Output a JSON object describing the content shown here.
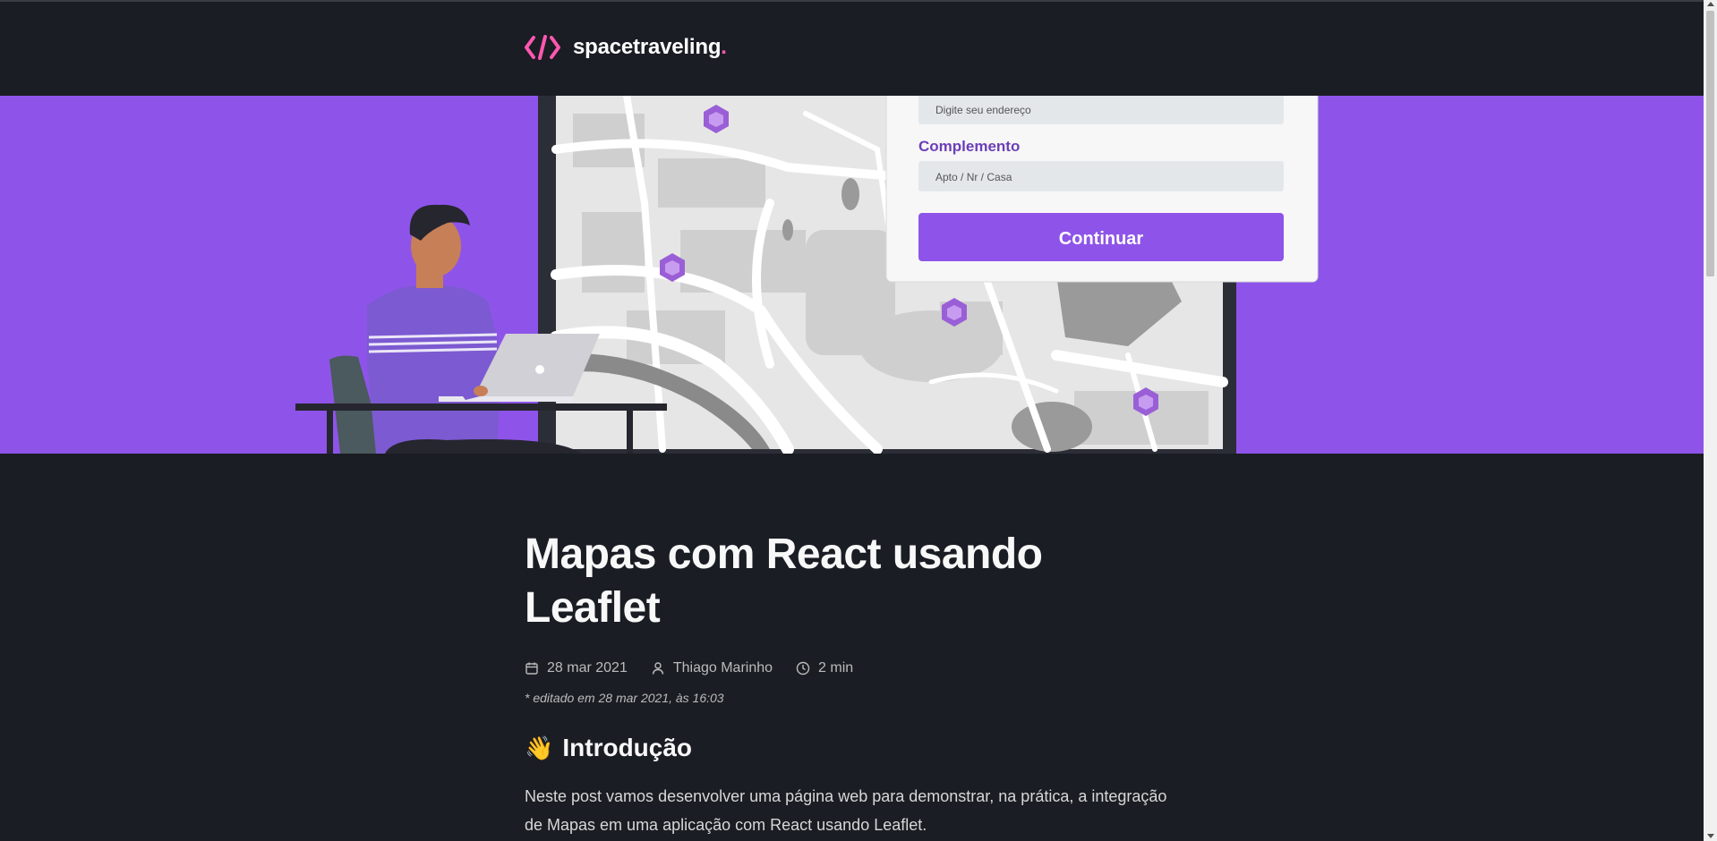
{
  "header": {
    "logo_symbol": "</>",
    "logo_text": "spacetraveling",
    "logo_dot": ".",
    "colors": {
      "accent": "#ff57b2",
      "background": "#1a1d23"
    }
  },
  "banner": {
    "background_color": "#8e54e9",
    "form": {
      "address_placeholder": "Digite seu endereço",
      "complement_label": "Complemento",
      "complement_placeholder": "Apto / Nr / Casa",
      "continue_button": "Continuar"
    }
  },
  "post": {
    "title": "Mapas com React usando Leaflet",
    "date": "28 mar 2021",
    "author": "Thiago Marinho",
    "reading_time": "2 min",
    "edited": "* editado em 28 mar 2021, às 16:03",
    "section_emoji": "👋",
    "section_title": "Introdução",
    "paragraph": "Neste post vamos desenvolver uma página web para demonstrar, na prática, a integração de Mapas em uma aplicação com React usando Leaflet."
  },
  "icons": {
    "logo": "code-brackets-icon",
    "date": "calendar-icon",
    "author": "user-icon",
    "reading_time": "clock-icon"
  }
}
